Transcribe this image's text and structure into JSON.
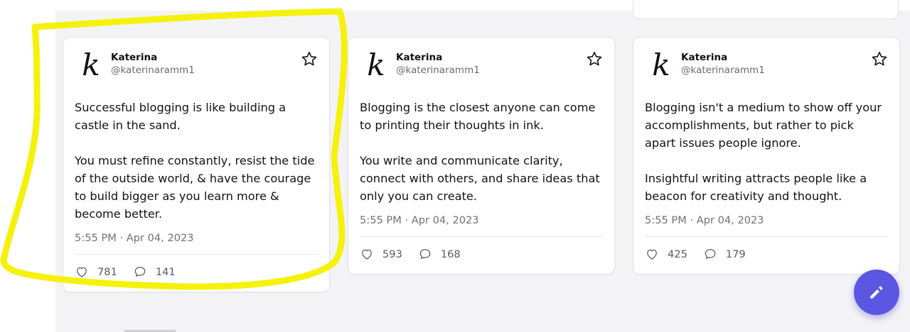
{
  "cards": [
    {
      "avatar_letter": "k",
      "author_name": "Katerina",
      "author_handle": "@katerinaramm1",
      "paragraphs": [
        "Successful blogging is like building a castle in the sand.",
        "You must refine constantly, resist the tide of the outside world, & have the courage to build bigger as you learn more & become better."
      ],
      "timestamp": "5:55 PM · Apr 04, 2023",
      "likes": "781",
      "comments": "141"
    },
    {
      "avatar_letter": "k",
      "author_name": "Katerina",
      "author_handle": "@katerinaramm1",
      "paragraphs": [
        "Blogging is the closest anyone can come to printing their thoughts in ink.",
        "You write and communicate clarity, connect with others, and share ideas that only you can create."
      ],
      "timestamp": "5:55 PM · Apr 04, 2023",
      "likes": "593",
      "comments": "168"
    },
    {
      "avatar_letter": "k",
      "author_name": "Katerina",
      "author_handle": "@katerinaramm1",
      "paragraphs": [
        "Blogging isn't a medium to show off your accomplishments, but rather to pick apart issues people ignore.",
        "Insightful writing attracts people like a beacon for creativity and thought."
      ],
      "timestamp": "5:55 PM · Apr 04, 2023",
      "likes": "425",
      "comments": "179"
    }
  ],
  "colors": {
    "fab": "#5b57e3",
    "highlight": "#f4f000",
    "background": "#f3f3f5"
  },
  "icons": {
    "favorite": "star-outline-icon",
    "like": "heart-outline-icon",
    "comment": "speech-bubble-icon",
    "compose": "pencil-icon"
  }
}
